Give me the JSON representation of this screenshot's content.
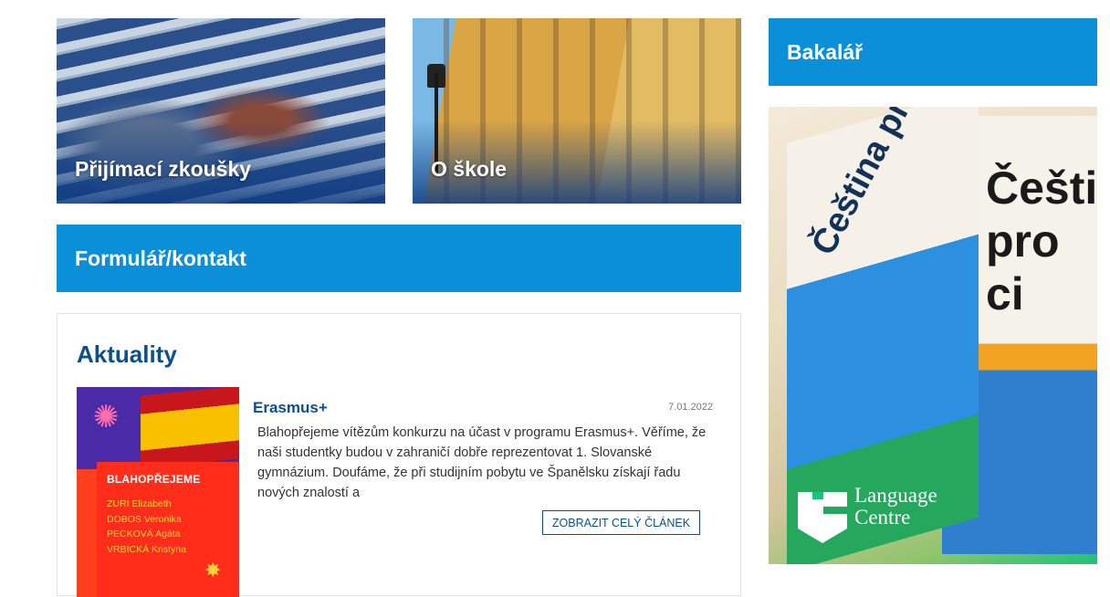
{
  "tiles": {
    "admission": {
      "label": "Přijímací zkoušky"
    },
    "about": {
      "label": "O škole"
    }
  },
  "sidebar": {
    "bakalar": {
      "label": "Bakalář"
    },
    "ad": {
      "logo_line1": "Language",
      "logo_line2": "Centre",
      "book_front_text": "Čeština pro cizince",
      "book_back_text": "Češti pro ci"
    }
  },
  "main": {
    "contact_banner": {
      "label": "Formulář/kontakt"
    },
    "news": {
      "heading": "Aktuality",
      "articles": [
        {
          "title": "Erasmus+",
          "date": "7.01.2022",
          "excerpt": "Blahopřejeme vítězům konkurzu na účast v programu Erasmus+. Věříme, že naši studentky budou v zahraničí dobře reprezentovat 1. Slovanské gymnázium. Doufáme, že při studijním pobytu ve Španělsku získají řadu nových znalostí a",
          "button_label": "ZOBRAZIT CELÝ ČLÁNEK",
          "image": {
            "heading": "BLAHOPŘEJEME",
            "names": [
              "ZURI Elizabeth",
              "DOBOS Veronika",
              "PECKOVÁ Agáta",
              "VRBICKÁ Kristyna"
            ]
          }
        }
      ]
    }
  },
  "colors": {
    "banner_blue": "#0a8fd8",
    "heading_navy": "#0c4f8c"
  }
}
